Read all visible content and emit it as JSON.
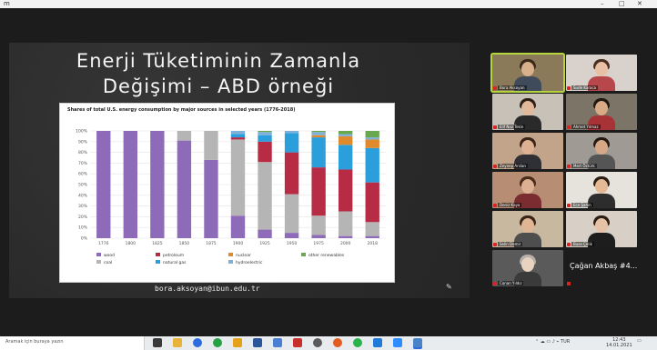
{
  "window": {
    "corner_label": "m"
  },
  "slide": {
    "title_line1": "Enerji Tüketiminin Zamanla",
    "title_line2": "Değişimi – ABD örneği",
    "footer_email": "bora.aksoyan@ibun.edu.tr"
  },
  "chart_data": {
    "type": "bar",
    "title": "Shares of total U.S. energy consumption by major sources in selected years (1776-2018)",
    "categories": [
      "1776",
      "1800",
      "1825",
      "1850",
      "1875",
      "1900",
      "1925",
      "1950",
      "1975",
      "2000",
      "2018"
    ],
    "ylim": [
      0,
      100
    ],
    "ytick_labels": [
      "0%",
      "10%",
      "20%",
      "30%",
      "40%",
      "50%",
      "60%",
      "70%",
      "80%",
      "90%",
      "100%"
    ],
    "series": [
      {
        "name": "wood",
        "color": "#8e6bb8",
        "values": [
          100,
          100,
          100,
          91,
          73,
          21,
          8,
          5,
          3,
          2,
          2
        ]
      },
      {
        "name": "coal",
        "color": "#b5b5b5",
        "values": [
          0,
          0,
          0,
          9,
          27,
          71,
          63,
          36,
          18,
          23,
          13
        ]
      },
      {
        "name": "petroleum",
        "color": "#b82b45",
        "values": [
          0,
          0,
          0,
          0,
          0,
          2,
          19,
          39,
          45,
          39,
          37
        ]
      },
      {
        "name": "natural gas",
        "color": "#2b9fdc",
        "values": [
          0,
          0,
          0,
          0,
          0,
          3,
          6,
          18,
          28,
          23,
          32
        ]
      },
      {
        "name": "nuclear",
        "color": "#e08a2e",
        "values": [
          0,
          0,
          0,
          0,
          0,
          0,
          0,
          0,
          2,
          8,
          8
        ]
      },
      {
        "name": "hydroelectric",
        "color": "#7fb0d8",
        "values": [
          0,
          0,
          0,
          0,
          0,
          3,
          3,
          2,
          3,
          2,
          2
        ]
      },
      {
        "name": "other renewables",
        "color": "#6aa84f",
        "values": [
          0,
          0,
          0,
          0,
          0,
          0,
          1,
          0,
          1,
          3,
          6
        ]
      }
    ],
    "legend": [
      "wood",
      "coal",
      "petroleum",
      "natural gas",
      "nuclear",
      "hydroelectric",
      "other renewables"
    ],
    "legend_position": "bottom",
    "grid": true
  },
  "participants": [
    {
      "name": "Bora Aksoyan"
    },
    {
      "name": "Sude Karaca"
    },
    {
      "name": "Elif Naz Tekin"
    },
    {
      "name": "Ahmet Yılmaz"
    },
    {
      "name": "Zeynep Arslan"
    },
    {
      "name": "Mert Öztürk"
    },
    {
      "name": "Deniz Kaya"
    },
    {
      "name": "Ece Şahin"
    },
    {
      "name": "Selin Demir"
    },
    {
      "name": "Buse Çelik"
    },
    {
      "name": "Canan Yıldız"
    },
    {
      "name": "Çağan Akbaş #4..."
    }
  ],
  "text_tile": {
    "label": "Çağan Akbaş #4..."
  },
  "taskbar": {
    "search_text": "Aramak için buraya yazın",
    "time": "12:43",
    "date": "14.01.2021"
  }
}
